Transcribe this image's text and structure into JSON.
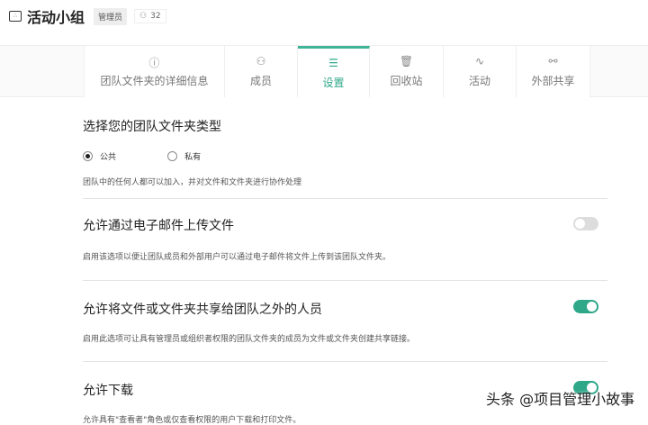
{
  "header": {
    "title": "活动小组",
    "role_badge": "管理员",
    "member_count": "32"
  },
  "tabs": [
    {
      "label": "团队文件夹的详细信息",
      "icon": "info-icon"
    },
    {
      "label": "成员",
      "icon": "members-icon"
    },
    {
      "label": "设置",
      "icon": "settings-sliders-icon",
      "active": true
    },
    {
      "label": "回收站",
      "icon": "trash-icon"
    },
    {
      "label": "活动",
      "icon": "activity-icon"
    },
    {
      "label": "外部共享",
      "icon": "link-icon"
    }
  ],
  "folder_type": {
    "heading": "选择您的团队文件夹类型",
    "options": [
      "公共",
      "私有"
    ],
    "selected": "公共",
    "desc": "团队中的任何人都可以加入，并对文件和文件夹进行协作处理"
  },
  "settings": [
    {
      "heading": "允许通过电子邮件上传文件",
      "desc": "启用该选项以便让团队成员和外部用户可以通过电子邮件将文件上传到该团队文件夹。",
      "enabled": false
    },
    {
      "heading": "允许将文件或文件夹共享给团队之外的人员",
      "desc": "启用此选项可让具有管理员或组织者权限的团队文件夹的成员为文件或文件夹创建共享链接。",
      "enabled": true
    },
    {
      "heading": "允许下载",
      "desc": "允许具有\"查看者\"角色或仅查看权限的用户下载和打印文件。",
      "enabled": true
    }
  ],
  "watermark": "头条 @项目管理小故事"
}
